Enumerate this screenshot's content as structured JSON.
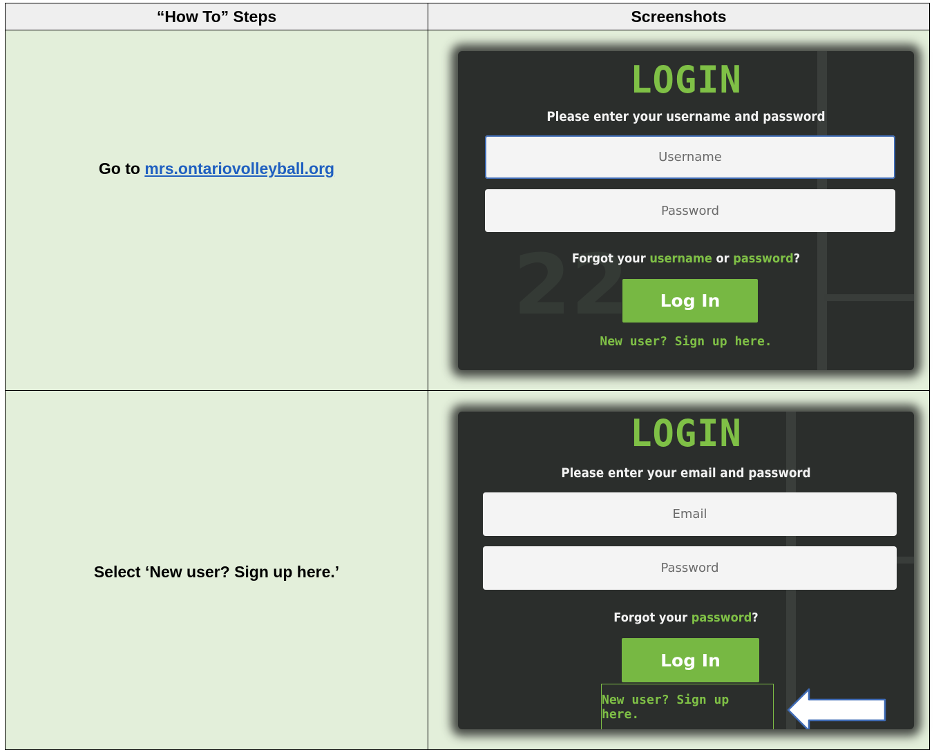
{
  "table": {
    "header_steps": "“How To” Steps",
    "header_screenshots": "Screenshots"
  },
  "steps": [
    {
      "prefix": "Go to ",
      "link_text": "mrs.ontariovolleyball.org"
    },
    {
      "text": "Select ‘New user? Sign up here.’"
    }
  ],
  "screens": [
    {
      "title": "LOGIN",
      "subtitle": "Please enter your username and password",
      "field1_placeholder": "Username",
      "field2_placeholder": "Password",
      "forgot_prefix": "Forgot your ",
      "forgot_link1": "username",
      "forgot_mid": " or ",
      "forgot_link2": "password",
      "forgot_suffix": "?",
      "login_button": "Log In",
      "new_user": "New user? Sign up here.",
      "background_number": "22"
    },
    {
      "title": "LOGIN",
      "subtitle": "Please enter your email and password",
      "field1_placeholder": "Email",
      "field2_placeholder": "Password",
      "forgot_prefix": "Forgot your ",
      "forgot_link": "password",
      "forgot_suffix": "?",
      "login_button": "Log In",
      "new_user": "New user? Sign up here."
    }
  ],
  "colors": {
    "accent_green": "#7fc046",
    "button_green": "#77b843",
    "panel_dark": "#2b2e2c",
    "cell_green": "#e3efda",
    "link_blue": "#1f5fc0"
  },
  "icons": [
    "right-pointing-arrow-icon"
  ]
}
